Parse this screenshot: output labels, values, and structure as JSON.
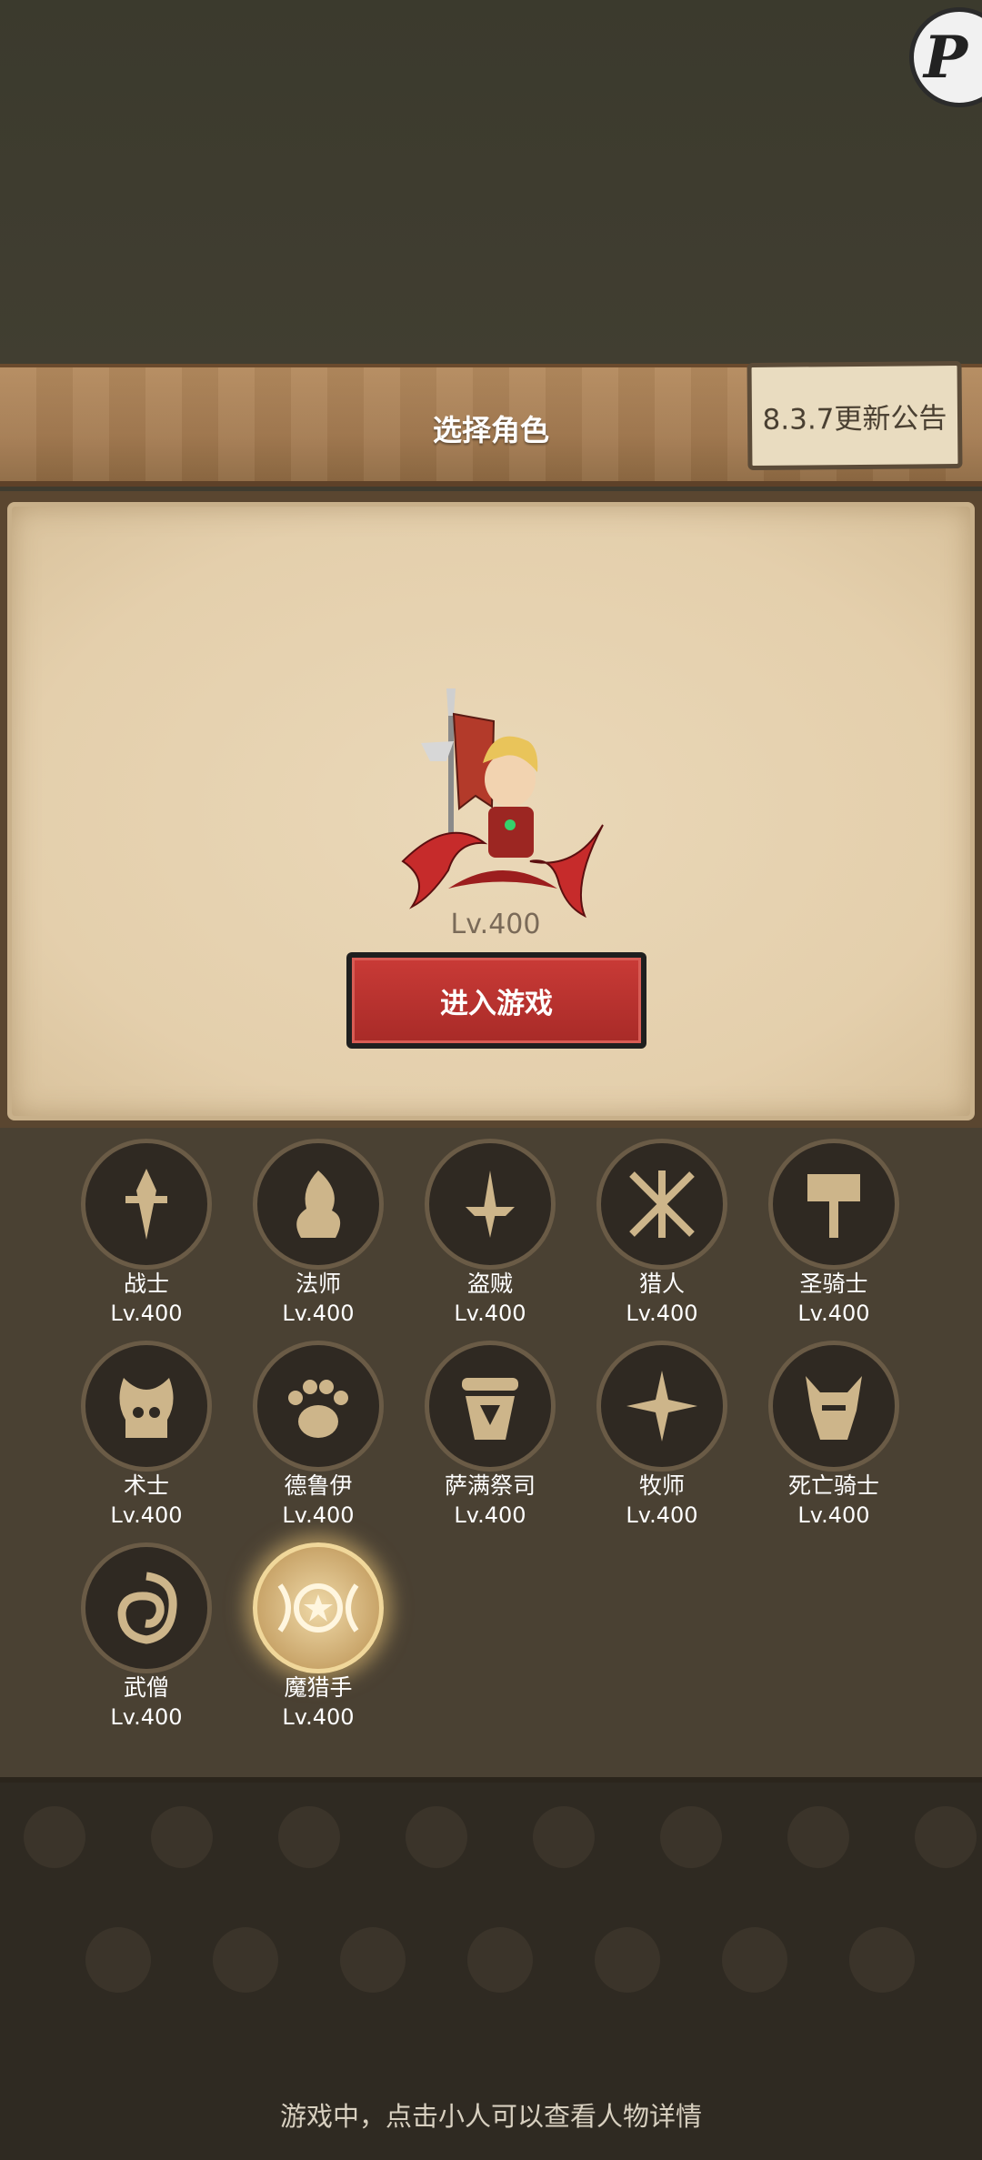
{
  "header": {
    "title": "选择角色",
    "notice_label": "8.3.7更新公告"
  },
  "hero": {
    "level": "Lv.400",
    "enter_label": "进入游戏"
  },
  "classes": [
    {
      "name": "战士",
      "level": "Lv.400",
      "icon": "sword-icon"
    },
    {
      "name": "法师",
      "level": "Lv.400",
      "icon": "flame-icon"
    },
    {
      "name": "盗贼",
      "level": "Lv.400",
      "icon": "dagger-icon"
    },
    {
      "name": "猎人",
      "level": "Lv.400",
      "icon": "crossed-arrows-icon"
    },
    {
      "name": "圣骑士",
      "level": "Lv.400",
      "icon": "hammer-icon"
    },
    {
      "name": "术士",
      "level": "Lv.400",
      "icon": "skull-icon"
    },
    {
      "name": "德鲁伊",
      "level": "Lv.400",
      "icon": "paw-icon"
    },
    {
      "name": "萨满祭司",
      "level": "Lv.400",
      "icon": "totem-icon"
    },
    {
      "name": "牧师",
      "level": "Lv.400",
      "icon": "star-burst-icon"
    },
    {
      "name": "死亡骑士",
      "level": "Lv.400",
      "icon": "helm-icon"
    },
    {
      "name": "武僧",
      "level": "Lv.400",
      "icon": "swirl-icon"
    },
    {
      "name": "魔猎手",
      "level": "Lv.400",
      "icon": "demon-star-icon",
      "selected": true
    }
  ],
  "footer": {
    "hint": "游戏中，点击小人可以查看人物详情"
  },
  "colors": {
    "enter_button": "#b83230",
    "parchment": "#e8d5b3",
    "wood": "#a57c52"
  }
}
